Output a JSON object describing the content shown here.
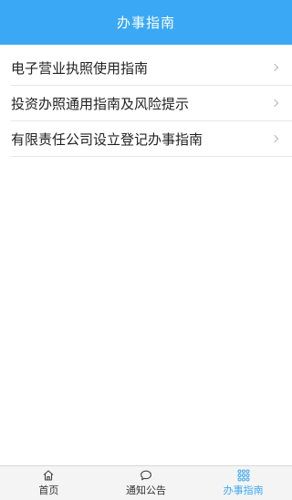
{
  "header": {
    "title": "办事指南"
  },
  "list": {
    "items": [
      {
        "label": "电子营业执照使用指南"
      },
      {
        "label": "投资办照通用指南及风险提示"
      },
      {
        "label": "有限责任公司设立登记办事指南"
      }
    ]
  },
  "tabbar": {
    "tabs": [
      {
        "label": "首页",
        "icon": "home-icon"
      },
      {
        "label": "通知公告",
        "icon": "speech-bubble-icon"
      },
      {
        "label": "办事指南",
        "icon": "grid-dots-icon",
        "active": true
      }
    ]
  },
  "colors": {
    "accent": "#3aa8f5",
    "header_text": "#ffffff",
    "text": "#222222",
    "tabbar_bg": "#f4f4f4"
  }
}
